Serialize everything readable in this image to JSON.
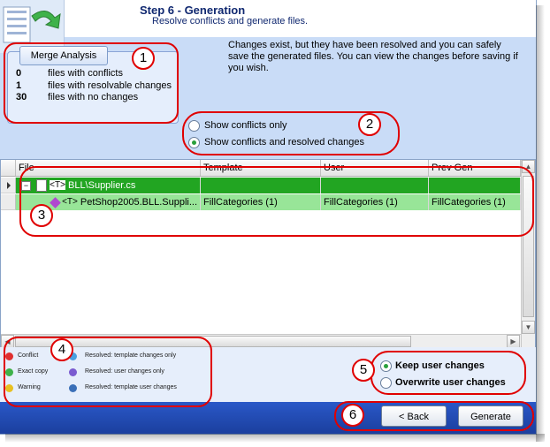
{
  "header": {
    "title": "Step 6 - Generation",
    "subtitle": "Resolve conflicts and generate files."
  },
  "summary": {
    "merge_button": "Merge Analysis",
    "items": [
      {
        "count": "0",
        "label": "files with conflicts"
      },
      {
        "count": "1",
        "label": "files with resolvable changes"
      },
      {
        "count": "30",
        "label": "files with no changes"
      }
    ]
  },
  "info_text": "Changes exist, but they have been resolved and you can safely save the generated files. You can view the changes before saving if you wish.",
  "filter": {
    "options": [
      "Show conflicts only",
      "Show conflicts and resolved changes"
    ],
    "selected": "Show conflicts and resolved changes"
  },
  "grid": {
    "columns": [
      "File",
      "Template",
      "User",
      "Prev Gen"
    ],
    "rows": [
      {
        "file": "BLL\\Supplier.cs",
        "template": "",
        "user": "",
        "prev_gen": ""
      },
      {
        "file": "PetShop2005.BLL.Suppli...",
        "template": "FillCategories (1)",
        "user": "FillCategories (1)",
        "prev_gen": "FillCategories (1)"
      }
    ],
    "node_type_label": "<T>",
    "expander": "−"
  },
  "legend": {
    "left": [
      "Conflict",
      "Exact copy",
      "Warning"
    ],
    "right": [
      "Resolved: template changes only",
      "Resolved: user changes only",
      "Resolved: template  user changes"
    ]
  },
  "merge_options": {
    "options": [
      "Keep user changes",
      "Overwrite user changes"
    ],
    "selected": "Keep user changes"
  },
  "buttons": {
    "back": "< Back",
    "generate": "Generate"
  },
  "callouts": [
    "1",
    "2",
    "3",
    "4",
    "5",
    "6"
  ],
  "colors": {
    "panel_bg": "#c9dcf7",
    "row_resolved_parent": "#22a522",
    "row_resolved_child": "#98e598",
    "callout_red": "#e00000",
    "footer_blue": "#1b3f9e"
  }
}
